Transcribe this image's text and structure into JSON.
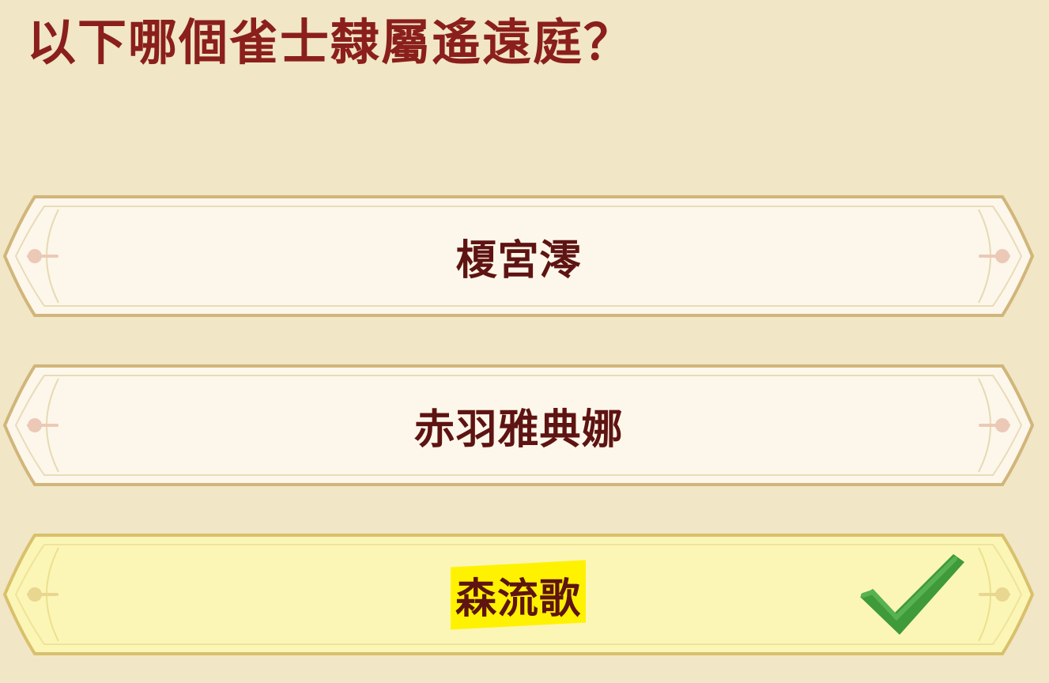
{
  "question": "以下哪個雀士隸屬遙遠庭？",
  "options": [
    {
      "label": "榎宮澪",
      "state": "normal"
    },
    {
      "label": "赤羽雅典娜",
      "state": "normal"
    },
    {
      "label": "森流歌",
      "state": "correct"
    }
  ],
  "colors": {
    "background": "#f1e6c6",
    "question_text": "#8a1f1c",
    "option_text": "#5e1412",
    "option_fill": "#fcf7ea",
    "option_correct_fill": "#fbf6b6",
    "highlight": "#fff200",
    "check": "#3f9a3a"
  },
  "icons": {
    "correct_indicator": "checkmark-icon",
    "frame_ornament": "fleur-ornament-icon"
  }
}
